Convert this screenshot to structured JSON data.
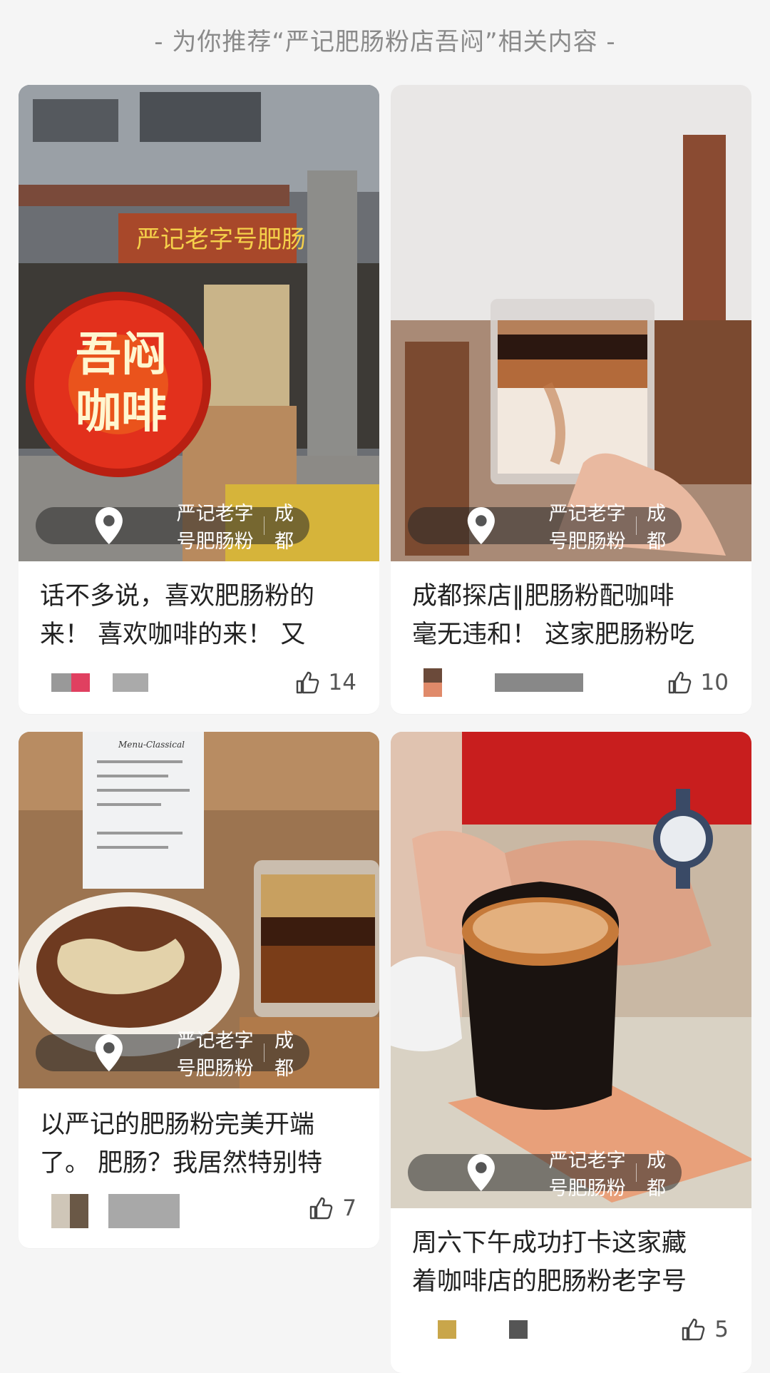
{
  "header": {
    "text": "- 为你推荐“严记肥肠粉店吾闷”相关内容 -"
  },
  "cards": [
    {
      "location": "严记老字号肥肠粉",
      "city": "成都",
      "title": "话不多说，喜欢肥肠粉的\n来！ 喜欢咖啡的来！ 又",
      "likes": "14",
      "sign_text": "吾闷\n咖啡",
      "shop_sign": "严记老字号肥肠"
    },
    {
      "location": "严记老字号肥肠粉",
      "city": "成都",
      "title": "成都探店‖肥肠粉配咖啡\n毫无违和！ 这家肥肠粉吃",
      "likes": "10"
    },
    {
      "location": "严记老字号肥肠粉",
      "city": "成都",
      "title": "以严记的肥肠粉完美开端\n了。 肥肠？我居然特别特",
      "likes": "7",
      "menu_title": "Menu-Classical"
    },
    {
      "location": "严记老字号肥肠粉",
      "city": "成都",
      "title": "周六下午成功打卡这家藏\n着咖啡店的肥肠粉老字号",
      "likes": "5"
    }
  ]
}
